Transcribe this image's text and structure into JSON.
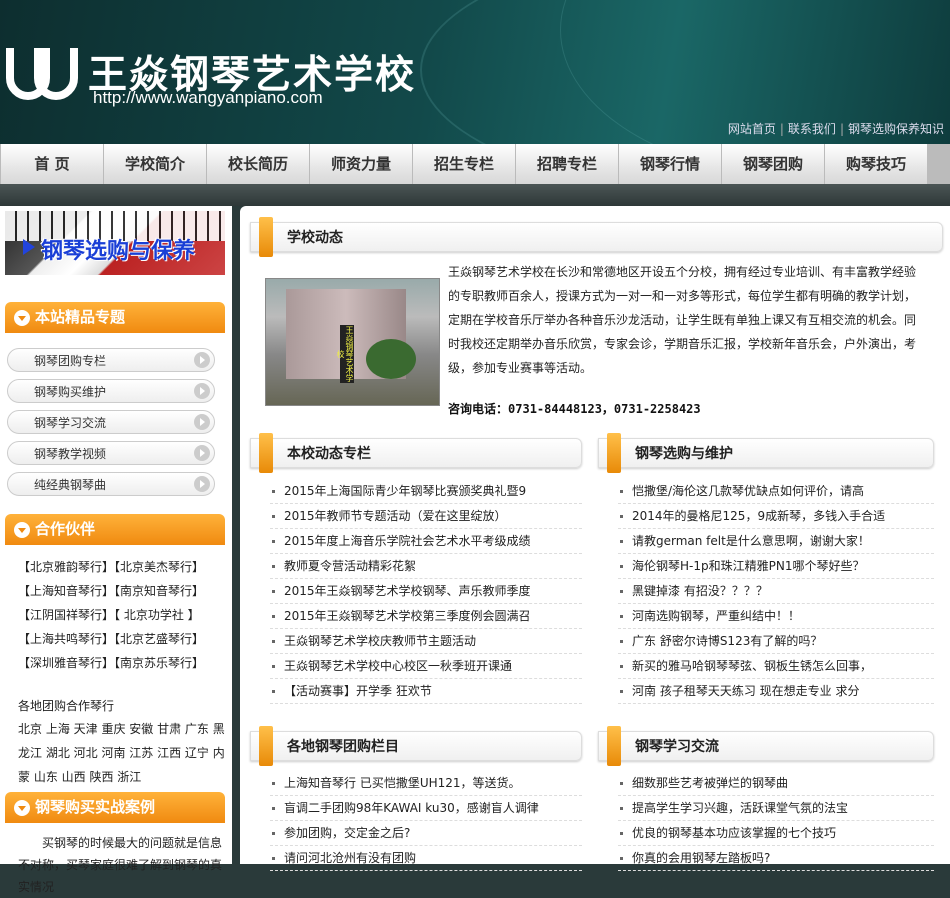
{
  "header": {
    "title": "王焱钢琴艺术学校",
    "url": "http://www.wangyanpiano.com",
    "toplinks": [
      "网站首页",
      "联系我们",
      "钢琴选购保养知识"
    ]
  },
  "nav": [
    "首 页",
    "学校简介",
    "校长简历",
    "师资力量",
    "招生专栏",
    "招聘专栏",
    "钢琴行情",
    "钢琴团购",
    "购琴技巧"
  ],
  "left": {
    "banner": "钢琴选购与保养",
    "featured_title": "本站精品专题",
    "featured": [
      "钢琴团购专栏",
      "钢琴购买维护",
      "钢琴学习交流",
      "钢琴教学视频",
      "纯经典钢琴曲"
    ],
    "partners_title": "合作伙伴",
    "partners": [
      "【北京雅韵琴行】【北京美杰琴行】",
      "【上海知音琴行】【南京知音琴行】",
      "【江阴国祥琴行】【 北京功学社 】",
      "【上海共鸣琴行】【北京艺盛琴行】",
      "【深圳雅音琴行】【南京苏乐琴行】"
    ],
    "cities_title": "各地团购合作琴行",
    "cities": "北京 上海 天津 重庆 安徽 甘肃 广东 黑龙江 湖北 河北 河南 江苏 江西 辽宁 内蒙 山东 山西 陕西 浙江",
    "cases_title": "钢琴购买实战案例",
    "cases_intro": "买钢琴的时候最大的问题就是信息不对称，买琴家庭很难了解到钢琴的真实情况"
  },
  "right": {
    "news_title": "学校动态",
    "intro": "王焱钢琴艺术学校在长沙和常德地区开设五个分校，拥有经过专业培训、有丰富教学经验的专职教师百余人，授课方式为一对一和一对多等形式，每位学生都有明确的教学计划，定期在学校音乐厅举办各种音乐沙龙活动，让学生既有单独上课又有互相交流的机会。同时我校还定期举办音乐欣赏，专家会诊，学期音乐汇报，学校新年音乐会，户外演出，考级，参加专业赛事等活动。",
    "phone_label": "咨询电话：",
    "phone": "0731-84448123，0731-2258423",
    "photo_sign": "王焱钢琴艺术学校",
    "col1_title": "本校动态专栏",
    "col1": [
      "2015年上海国际青少年钢琴比赛颁奖典礼暨9",
      "2015年教师节专题活动（爱在这里绽放）",
      "2015年度上海音乐学院社会艺术水平考级成绩",
      "教师夏令营活动精彩花絮",
      "2015年王焱钢琴艺术学校钢琴、声乐教师季度",
      "2015年王焱钢琴艺术学校第三季度例会圆满召",
      "王焱钢琴艺术学校庆教师节主题活动",
      "王焱钢琴艺术学校中心校区一秋季班开课通",
      "【活动赛事】开学季 狂欢节"
    ],
    "col2_title": "钢琴选购与维护",
    "col2": [
      "恺撒堡/海伦这几款琴优缺点如何评价，请高",
      "2014年的曼格尼125，9成新琴，多钱入手合适",
      "请教german felt是什么意思啊，谢谢大家！",
      "海伦钢琴H-1p和珠江精雅PN1哪个琴好些？",
      "黑键掉漆 有招没？？？？",
      "河南选购钢琴，严重纠结中！！",
      "广东 舒密尔诗博S123有了解的吗？",
      "新买的雅马哈钢琴琴弦、钢板生锈怎么回事，",
      "河南 孩子租琴天天练习 现在想走专业 求分"
    ],
    "col3_title": "各地钢琴团购栏目",
    "col3": [
      "上海知音琴行 已买恺撒堡UH121，等送货。",
      "盲调二手团购98年KAWAI ku30，感谢盲人调律",
      "参加团购，交定金之后?",
      "请问河北沧州有没有团购"
    ],
    "col4_title": "钢琴学习交流",
    "col4": [
      "细数那些艺考被弹烂的钢琴曲",
      "提高学生学习兴趣，活跃课堂气氛的法宝",
      "优良的钢琴基本功应该掌握的七个技巧",
      "你真的会用钢琴左踏板吗?"
    ]
  }
}
